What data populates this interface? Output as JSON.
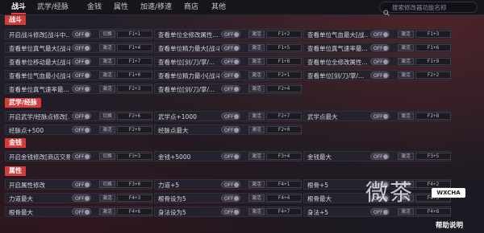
{
  "tabs": [
    "战斗",
    "武学/经脉",
    "金钱",
    "属性",
    "加速/移速",
    "商店",
    "其他"
  ],
  "search": {
    "placeholder": "搜索修改器功能名称"
  },
  "toggle_label": "OFF",
  "sections": [
    {
      "title": "战斗",
      "rows": [
        {
          "label": "开启战斗修改[战斗中...",
          "action": "切换",
          "key": "F1+1"
        },
        {
          "label": "查看单位全修改属性...",
          "action": "激活",
          "key": "F1+2"
        },
        {
          "label": "查看单位气血最大[战...",
          "action": "激活",
          "key": "F1+3"
        },
        {
          "label": "查看单位真气最大[战斗...",
          "action": "激活",
          "key": "F1+4"
        },
        {
          "label": "查看单位精力最大[战斗...",
          "action": "激活",
          "key": "F1+5"
        },
        {
          "label": "查看单位真气速率最...",
          "action": "激活",
          "key": "F1+6"
        },
        {
          "label": "查看单位移动最大[战斗...",
          "action": "激活",
          "key": "F1+7"
        },
        {
          "label": "查看单位[剑/刀/掌/...",
          "action": "激活",
          "key": "F1+8"
        },
        {
          "label": "查看单位全修改属性...",
          "action": "激活",
          "key": "F1+9"
        },
        {
          "label": "查看单位气血最小[战斗...",
          "action": "激活",
          "key": "F1+0"
        },
        {
          "label": "查看单位精力最小[战斗...",
          "action": "激活",
          "key": "F2+1"
        },
        {
          "label": "查看单位[剑/刀/掌/...",
          "action": "激活",
          "key": "F2+2"
        },
        {
          "label": "查看单位真气速率最...",
          "action": "激活",
          "key": "F2+3"
        },
        {
          "label": "查看单位[剑/刀/掌/...",
          "action": "激活",
          "key": "F2+4"
        }
      ]
    },
    {
      "title": "武学/经脉",
      "rows": [
        {
          "label": "开启武学/经脉点修改[...",
          "action": "切换",
          "key": "F2+6"
        },
        {
          "label": "武学点+1000",
          "action": "激活",
          "key": "F2+7"
        },
        {
          "label": "武学点最大",
          "action": "激活",
          "key": "F2+8"
        },
        {
          "label": "经脉点+500",
          "action": "激活",
          "key": "F2+9"
        },
        {
          "label": "经脉点最大",
          "action": "激活",
          "key": "F2+0"
        }
      ]
    },
    {
      "title": "金钱",
      "rows": [
        {
          "label": "开启金钱修改[商店交易...",
          "action": "切换",
          "key": "F3+3"
        },
        {
          "label": "金钱+5000",
          "action": "激活",
          "key": "F3+4"
        },
        {
          "label": "金钱最大",
          "action": "激活",
          "key": "F3+5"
        }
      ]
    },
    {
      "title": "属性",
      "rows": [
        {
          "label": "开启属性修改",
          "action": "切换",
          "key": "F3+0"
        },
        {
          "label": "力道+5",
          "action": "激活",
          "key": "F4+1"
        },
        {
          "label": "根骨+5",
          "action": "激活",
          "key": "F4+2"
        },
        {
          "label": "力道最大",
          "action": "激活",
          "key": "F4+3"
        },
        {
          "label": "根骨设为5",
          "action": "激活",
          "key": "F4+4"
        },
        {
          "label": "根骨最大",
          "action": "激活",
          "key": "F4+5"
        },
        {
          "label": "根骨最大",
          "action": "激活",
          "key": "F4+6"
        },
        {
          "label": "身法设为5",
          "action": "激活",
          "key": "F4+7"
        },
        {
          "label": "身法+5",
          "action": "激活",
          "key": "F4+8"
        }
      ]
    }
  ],
  "watermark": {
    "text": "微茶",
    "badge": "WXCHA"
  },
  "footer": {
    "help": "帮助说明"
  },
  "colors": {
    "accent": "#d43c3c",
    "background": "#1b1921",
    "row": "#24222c"
  }
}
